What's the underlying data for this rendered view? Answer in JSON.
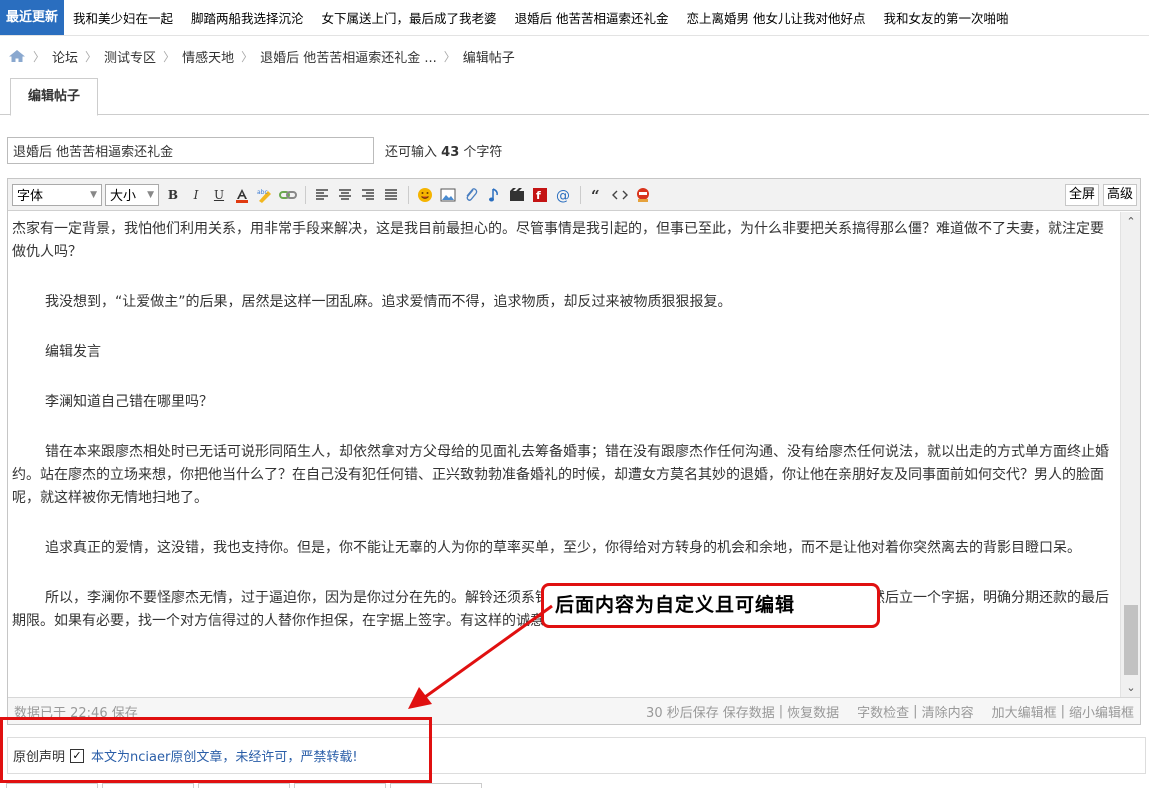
{
  "newsbar": {
    "badge": "最近更新",
    "items": [
      "我和美少妇在一起",
      "脚踏两船我选择沉沦",
      "女下属送上门，最后成了我老婆",
      "退婚后 他苦苦相逼索还礼金",
      "恋上离婚男 他女儿让我对他好点",
      "我和女友的第一次啪啪"
    ]
  },
  "breadcrumb": {
    "icon": "home-icon",
    "items": [
      "论坛",
      "测试专区",
      "情感天地",
      "退婚后 他苦苦相逼索还礼金 ...",
      "编辑帖子"
    ]
  },
  "tabs": {
    "active": "编辑帖子"
  },
  "subject": {
    "value": "退婚后 他苦苦相逼索还礼金",
    "counter_prefix": "还可输入",
    "counter_num": "43",
    "counter_suffix": "个字符"
  },
  "toolbar": {
    "font_label": "字体",
    "size_label": "大小",
    "bold": "B",
    "italic": "I",
    "underline": "U",
    "fullscreen": "全屏",
    "advanced": "高级"
  },
  "content": {
    "paragraphs": [
      "杰家有一定背景，我怕他们利用关系，用非常手段来解决，这是我目前最担心的。尽管事情是我引起的，但事已至此，为什么非要把关系搞得那么僵？难道做不了夫妻，就注定要做仇人吗？",
      "我没想到，“让爱做主”的后果，居然是这样一团乱麻。追求爱情而不得，追求物质，却反过来被物质狠狠报复。",
      "编辑发言",
      "李澜知道自己错在哪里吗？",
      "错在本来跟廖杰相处时已无话可说形同陌生人，却依然拿对方父母给的见面礼去筹备婚事；错在没有跟廖杰作任何沟通、没有给廖杰任何说法，就以出走的方式单方面终止婚约。站在廖杰的立场来想，你把他当什么了？在自己没有犯任何错、正兴致勃勃准备婚礼的时候，却遭女方莫名其妙的退婚，你让他在亲朋好友及同事面前如何交代？男人的脸面呢，就这样被你无情地扫地了。",
      "追求真正的爱情，这没错，我也支持你。但是，你不能让无辜的人为你的草率买单，至少，你得给对方转身的机会和余地，而不是让他对着你突然离去的背影目瞪口呆。",
      "所以，李澜你不要怪廖杰无情，过于逼迫你，因为是你过分在先的。解铃还须系铃人，现在，你得低下头来，好好向廖杰及家人道歉，然后立一个字据，明确分期还款的最后期限。如果有必要，找一个对方信得过的人替你作担保，在字据上签字。有这样的诚意在，相信廖杰会让你一步。"
    ]
  },
  "statusbar": {
    "saved": "数据已于 22:46 保存",
    "autosave": "30 秒后保存",
    "save_data": "保存数据",
    "restore": "恢复数据",
    "word_check": "字数检查",
    "clear": "清除内容",
    "enlarge": "加大编辑框",
    "shrink": "缩小编辑框"
  },
  "statement": {
    "label": "原创声明",
    "checked": true,
    "check_glyph": "✓",
    "notice": "本文为nciaer原创文章，未经许可，严禁转载!"
  },
  "annotation": {
    "callout": "后面内容为自定义且可编辑",
    "color": "#e01010"
  }
}
